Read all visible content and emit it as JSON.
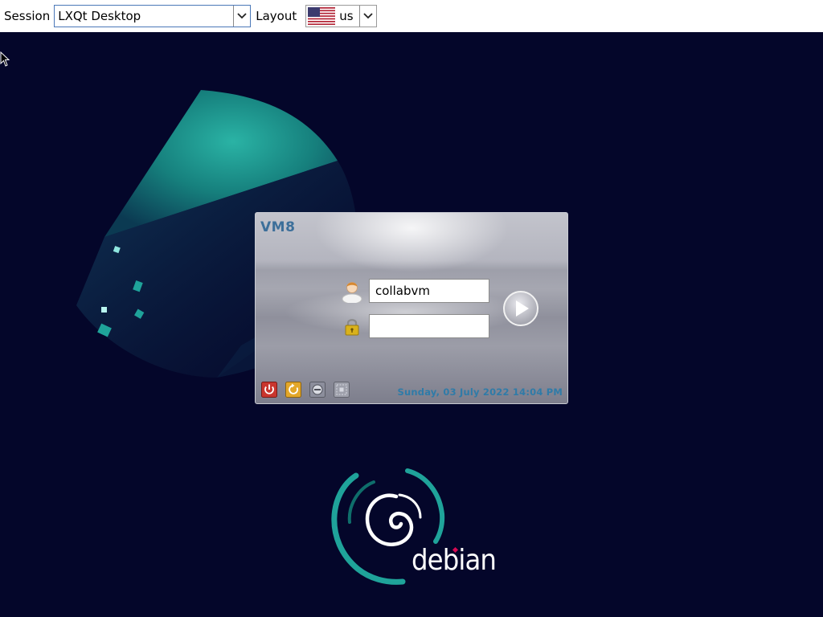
{
  "topbar": {
    "session_label": "Session",
    "session_value": "LXQt Desktop",
    "layout_label": "Layout",
    "layout_value": "us",
    "layout_flag_icon": "us-flag-icon"
  },
  "login": {
    "hostname": "VM8",
    "username_value": "collabvm",
    "password_value": "",
    "datetime": "Sunday, 03 July 2022 14:04 PM",
    "actions": [
      "shutdown-icon",
      "restart-icon",
      "suspend-icon",
      "hibernate-icon"
    ]
  },
  "branding": {
    "logo_text": "debian",
    "accent_color": "#1fa39a",
    "logo_red": "#d70a53"
  },
  "colors": {
    "background": "#04062a",
    "host_text": "#3c6f9a",
    "datetime_text": "#2f7ba8"
  }
}
